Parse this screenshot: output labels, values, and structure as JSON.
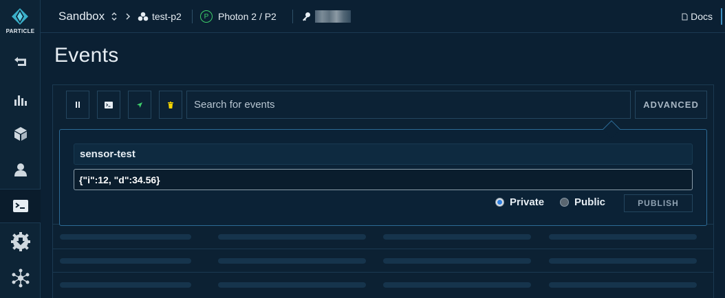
{
  "brand": {
    "name": "PARTICLE"
  },
  "breadcrumb": {
    "sandbox": "Sandbox",
    "product": "test-p2",
    "device_badge": "P",
    "device": "Photon 2 / P2"
  },
  "header": {
    "docs_label": "Docs"
  },
  "page": {
    "title": "Events"
  },
  "events": {
    "search_placeholder": "Search for events",
    "advanced_label": "ADVANCED"
  },
  "publish": {
    "event_name": "sensor-test",
    "event_data": "{\"i\":12, \"d\":34.56}",
    "private_label": "Private",
    "public_label": "Public",
    "publish_label": "PUBLISH",
    "visibility": "Private"
  },
  "colors": {
    "background": "#0b2033",
    "accent": "#2d6c97",
    "play_icon": "#3ecf6b",
    "trash_icon": "#f5d400",
    "device_badge": "#3ecf6b"
  }
}
